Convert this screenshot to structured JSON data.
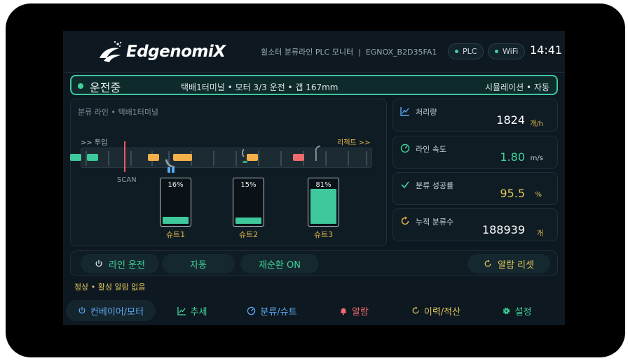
{
  "header": {
    "brand": "EdgenomiX",
    "subtitle": "휠소터 분류라인 PLC 모니터  |  EGNOX_B2D35FA1",
    "plc_label": "PLC",
    "wifi_label": "WiFi",
    "time": "14:41"
  },
  "status": {
    "state": "운전중",
    "info": "택배1터미널 • 모터 3/3 운전 • 갭 167mm",
    "mode": "시뮬레이션 • 자동"
  },
  "line": {
    "title": "분류 라인 • 택배1터미널",
    "infeed_label": ">> 투입",
    "reject_label": "리젝트 >>",
    "scan_label": "SCAN",
    "chutes": [
      {
        "label": "슈트1",
        "percent_text": "16%",
        "fill": 16
      },
      {
        "label": "슈트2",
        "percent_text": "15%",
        "fill": 15
      },
      {
        "label": "슈트3",
        "percent_text": "81%",
        "fill": 81
      }
    ]
  },
  "stats": [
    {
      "label": "처리량",
      "value": "1824",
      "unit": "개/h"
    },
    {
      "label": "라인 속도",
      "value": "1.80",
      "unit": "m/s"
    },
    {
      "label": "분류 성공률",
      "value": "95.5",
      "unit": "%"
    },
    {
      "label": "누적 분류수",
      "value": "188939",
      "unit": "개"
    }
  ],
  "controls": {
    "run_label": "라인 운전",
    "auto_label": "자동",
    "recirc_label": "재순환 ON",
    "alarm_reset_label": "알람 리셋"
  },
  "note": "정상 • 활성 알람 없음",
  "nav": [
    {
      "label": "컨베이어/모터"
    },
    {
      "label": "추세"
    },
    {
      "label": "분류/슈트"
    },
    {
      "label": "알람"
    },
    {
      "label": "이력/적산"
    },
    {
      "label": "설정"
    }
  ],
  "colors": {
    "accent": "#3fd39a",
    "warn": "#e0b34a",
    "alarm": "#f06b6b",
    "info": "#5aa8f0"
  }
}
